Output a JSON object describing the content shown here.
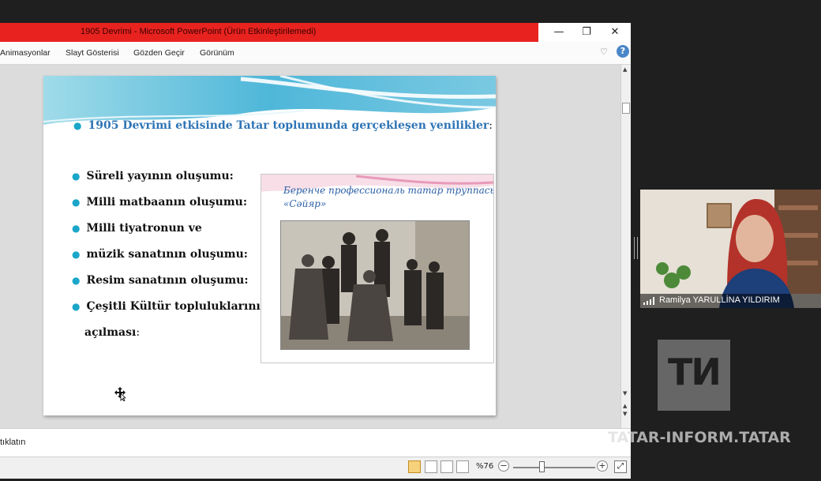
{
  "window": {
    "title": "1905 Devrimi  -  Microsoft PowerPoint (Ürün Etkinleştirilemedi)",
    "minimize_icon": "minimize-icon",
    "restore_icon": "restore-icon",
    "close_icon": "close-icon"
  },
  "menu": {
    "items": [
      "Animasyonlar",
      "Slayt Gösterisi",
      "Gözden Geçir",
      "Görünüm"
    ]
  },
  "slide": {
    "heading": "1905 Devrimi etkisinde Tatar toplumunda gerçekleşen yenilikler",
    "heading_suffix": ":",
    "bullets": [
      "Süreli yayının oluşumu:",
      "Milli matbaanın oluşumu:",
      "Milli tiyatronun ve",
      "müzik sanatının oluşumu:",
      "Resim sanatının oluşumu:",
      "Çeşitli Kültür topluluklarının"
    ],
    "continuation": "açılması",
    "continuation_suffix": ":",
    "photo_caption_line1": "Беренче профессиональ татар труппасы",
    "photo_caption_line2": "«Сәйяр»"
  },
  "notes": {
    "text": "tıklatın"
  },
  "status": {
    "zoom_label": "%76",
    "zoom_level_percent": 76
  },
  "webcam": {
    "participant_name": "Ramilya YARULLİNA YILDIRIM"
  },
  "watermark": {
    "logo": "ТИ",
    "text": "TATAR-INFORM.TATAR"
  },
  "colors": {
    "titlebar_red": "#e8231f",
    "heading_blue": "#2e74b5",
    "bullet_cyan": "#1aa6c8"
  }
}
